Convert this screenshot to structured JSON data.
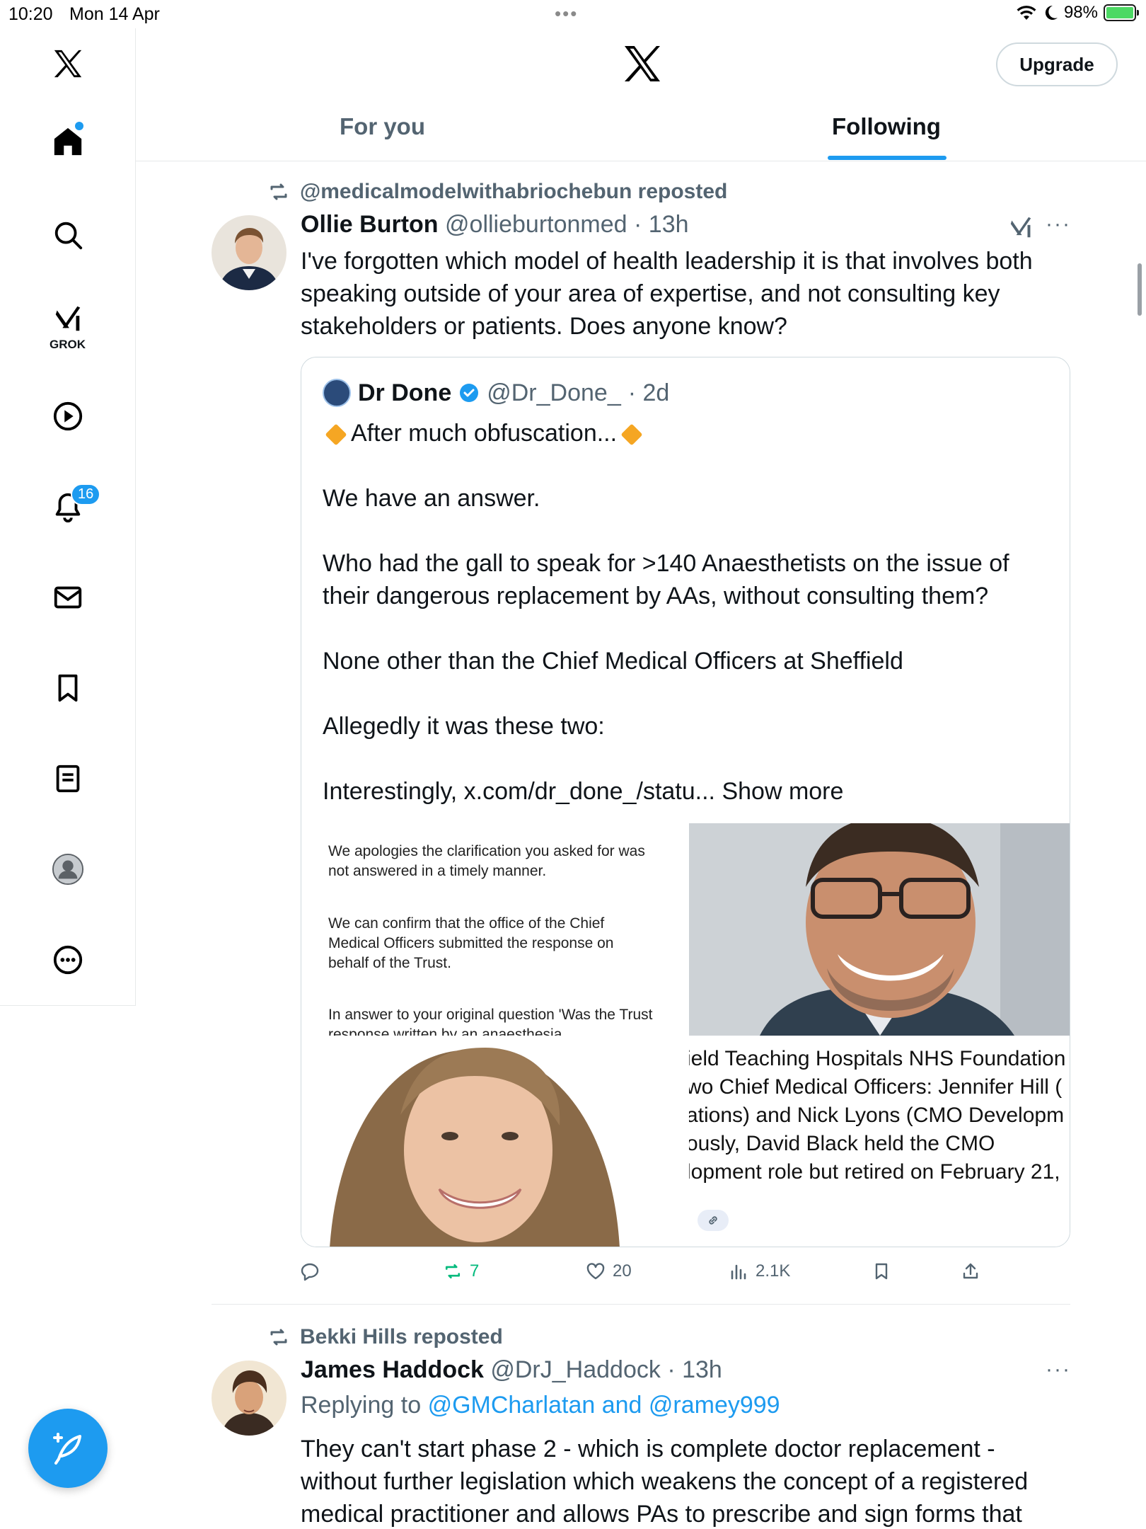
{
  "status_bar": {
    "time": "10:20",
    "date": "Mon 14 Apr",
    "dots": "•••",
    "battery": "98%"
  },
  "sidebar": {
    "grok_label": "GROK",
    "notification_count": "16"
  },
  "header": {
    "upgrade_label": "Upgrade",
    "tabs": [
      {
        "label": "For you",
        "active": false
      },
      {
        "label": "Following",
        "active": true
      }
    ]
  },
  "tweets": [
    {
      "repost_by": "@medicalmodelwithabriochebun reposted",
      "author_name": "Ollie Burton",
      "author_handle": "@ollieburtonmed",
      "time": "· 13h",
      "more": "···",
      "text_lines": [
        "I've forgotten which model of health leadership it is that involves both",
        "speaking outside of your area of expertise, and not consulting key",
        "stakeholders or patients. Does anyone know?"
      ],
      "quote": {
        "author_name": "Dr Done",
        "author_handle": "@Dr_Done_",
        "time": "· 2d",
        "headline": "After much obfuscation...",
        "lines": [
          "We have an answer.",
          "Who had the gall to speak for >140 Anaesthetists on the issue of",
          "their dangerous replacement by AAs, without consulting them?",
          "None other than the Chief Medical Officers at  Sheffield",
          "Allegedly it was these two:",
          "Interestingly, x.com/dr_done_/statu..."
        ],
        "show_more": "Show more",
        "letter_paragraphs": [
          "We apologies the clarification you asked for was not answered in a timely manner.",
          "We can confirm that the office of the Chief Medical Officers submitted the response on behalf of the Trust.",
          "In answer to your original question 'Was the Trust response written by an anaesthesia"
        ],
        "article_lines": [
          "ield Teaching Hospitals NHS Foundation",
          "wo Chief Medical Officers: Jennifer Hill (",
          "ations) and Nick Lyons (CMO Developm",
          "ously, David Black held the CMO",
          "lopment role but retired on February 21,"
        ]
      },
      "actions": {
        "replies": "",
        "reposts": "7",
        "likes": "20",
        "views": "2.1K"
      }
    },
    {
      "repost_by": "Bekki Hills reposted",
      "author_name": "James Haddock",
      "author_handle": "@DrJ_Haddock",
      "time": "· 13h",
      "more": "···",
      "replying_prefix": "Replying to",
      "replying_to": "@GMCharlatan and @ramey999",
      "text_lines": [
        "They can't start phase 2 - which is complete doctor replacement -",
        "without further legislation which weakens the concept of a registered",
        "medical practitioner and allows PAs to prescribe and sign forms that"
      ]
    }
  ],
  "colors": {
    "accent": "#1d9bf0",
    "repost_green": "#00ba7c",
    "secondary_text": "#536471"
  }
}
